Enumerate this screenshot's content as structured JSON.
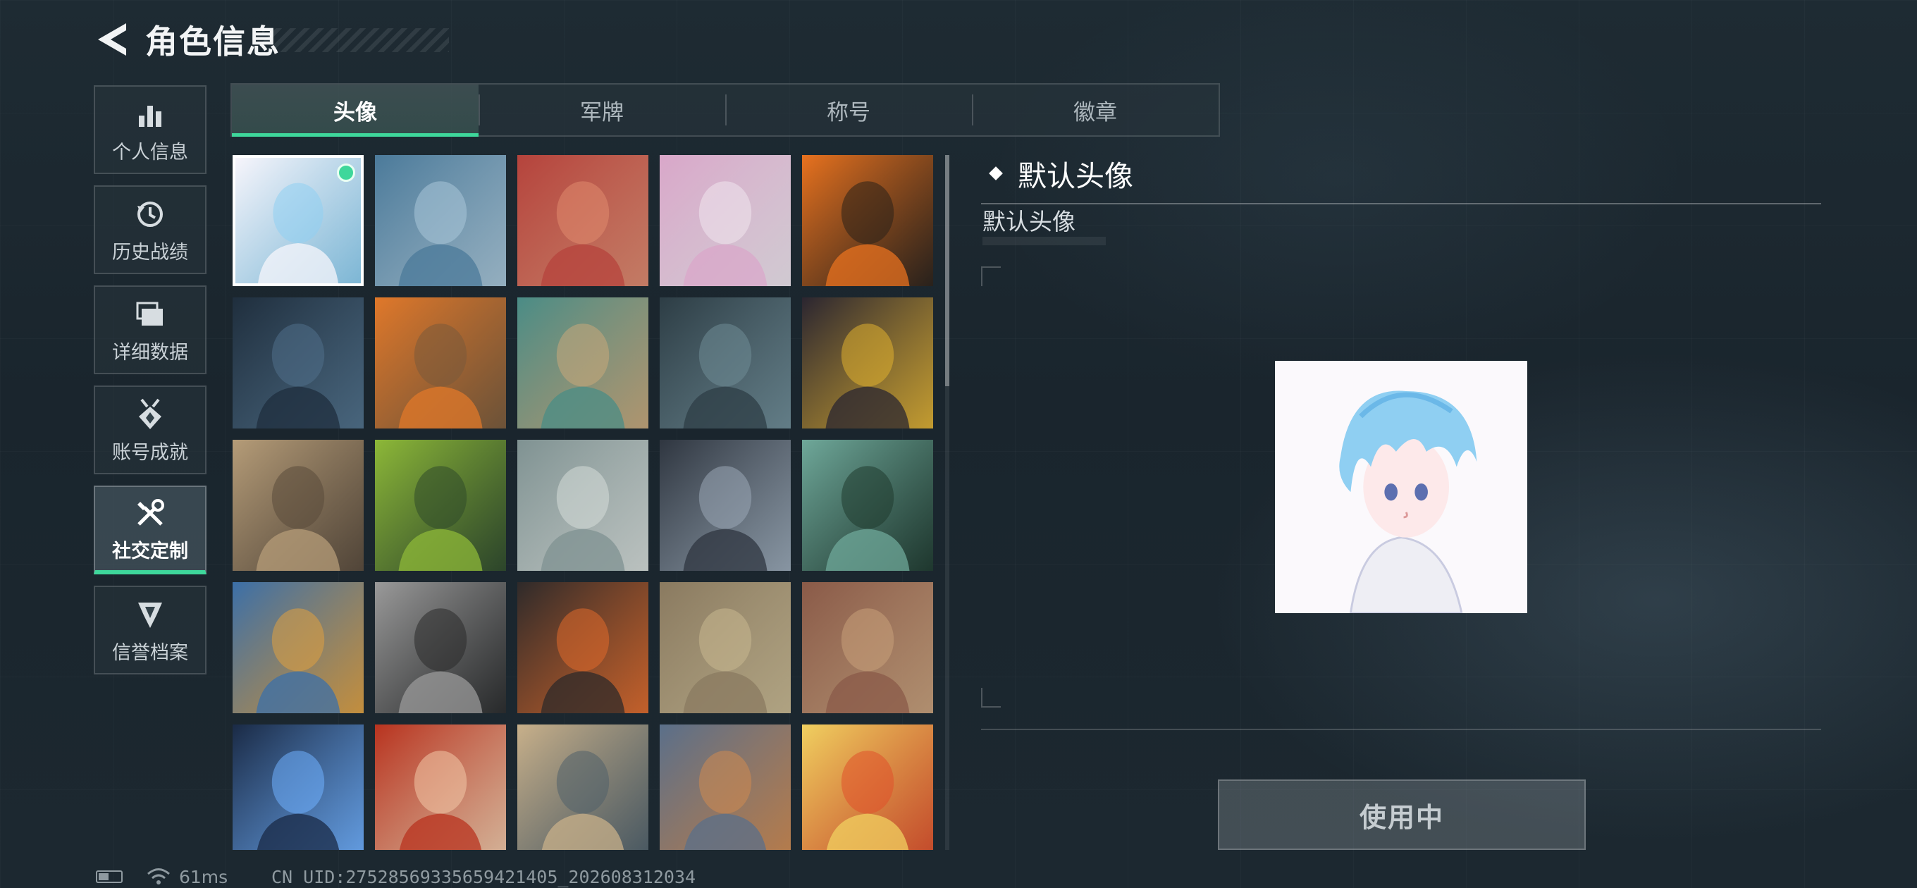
{
  "header": {
    "title": "角色信息",
    "back_icon": "back-arrow-icon"
  },
  "side_menu": [
    {
      "label": "个人信息",
      "icon": "bar-chart-icon",
      "active": false
    },
    {
      "label": "历史战绩",
      "icon": "history-clock-icon",
      "active": false
    },
    {
      "label": "详细数据",
      "icon": "folder-stack-icon",
      "active": false
    },
    {
      "label": "账号成就",
      "icon": "achievement-medal-icon",
      "active": false
    },
    {
      "label": "社交定制",
      "icon": "tools-wrench-icon",
      "active": true
    },
    {
      "label": "信誉档案",
      "icon": "credit-shield-icon",
      "active": false
    }
  ],
  "tabs": [
    {
      "label": "头像",
      "active": true
    },
    {
      "label": "军牌",
      "active": false
    },
    {
      "label": "称号",
      "active": false
    },
    {
      "label": "徽章",
      "active": false
    }
  ],
  "avatars": {
    "selected_index": 0,
    "scroll_position": 0.33,
    "palette": [
      [
        "#f7f5fb",
        "#8fd0f2"
      ],
      [
        "#4b7a9a",
        "#a9c6d8"
      ],
      [
        "#b5433c",
        "#e08a6e"
      ],
      [
        "#d9a7c9",
        "#f0e6ee"
      ],
      [
        "#e8721f",
        "#2a2018"
      ],
      [
        "#1f2e3d",
        "#50708a"
      ],
      [
        "#e0782a",
        "#7a5a3a"
      ],
      [
        "#4a8c86",
        "#c9a87a"
      ],
      [
        "#2d3d45",
        "#6f8c96"
      ],
      [
        "#2a2530",
        "#e0b030"
      ],
      [
        "#b59c78",
        "#5a4a3a"
      ],
      [
        "#8db838",
        "#2f4a2a"
      ],
      [
        "#7f9292",
        "#d6dcd8"
      ],
      [
        "#2f3640",
        "#9aa8b6"
      ],
      [
        "#6fa89a",
        "#1f3a2e"
      ],
      [
        "#3b6fa8",
        "#e0a040"
      ],
      [
        "#9a9a9a",
        "#2a2a2a"
      ],
      [
        "#2e2a2a",
        "#e06a2a"
      ],
      [
        "#8a7a60",
        "#c9b890"
      ],
      [
        "#8a5a48",
        "#c9a07a"
      ],
      [
        "#1a2a45",
        "#6fb0ff"
      ],
      [
        "#b8331f",
        "#f3c9a8"
      ],
      [
        "#c8b08a",
        "#50606a"
      ],
      [
        "#5a6f8a",
        "#d08a50"
      ],
      [
        "#f0d060",
        "#e0502a"
      ]
    ]
  },
  "detail": {
    "title": "默认头像",
    "subtitle": "默认头像",
    "button_label": "使用中"
  },
  "status_bar": {
    "ping": "61ms",
    "uid": "CN UID:27528569335659421405_202608312034"
  }
}
